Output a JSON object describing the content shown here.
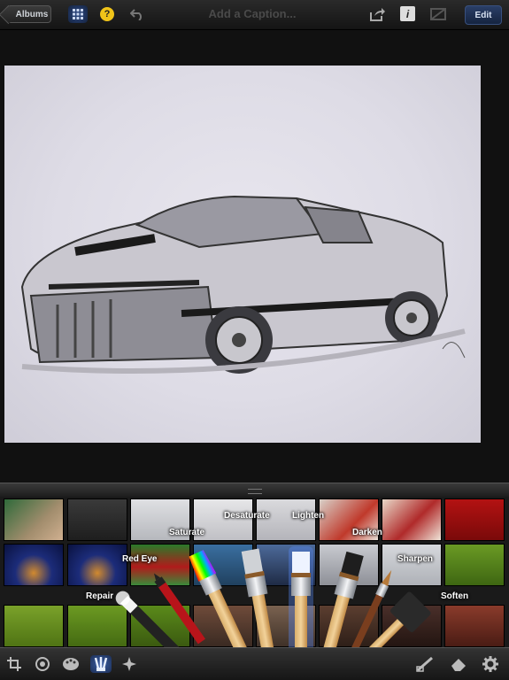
{
  "toolbar": {
    "albums_label": "Albums",
    "caption_placeholder": "Add a Caption...",
    "edit_label": "Edit",
    "help_glyph": "?",
    "info_glyph": "i",
    "icons": [
      "grid-icon",
      "help-icon",
      "undo-icon",
      "share-icon",
      "info-icon",
      "compare-icon"
    ]
  },
  "brush_tools": {
    "saturate": "Saturate",
    "desaturate": "Desaturate",
    "lighten": "Lighten",
    "darken": "Darken",
    "red_eye": "Red Eye",
    "sharpen": "Sharpen",
    "repair": "Repair",
    "soften": "Soften"
  },
  "bottom_tools": {
    "icons": [
      "crop-icon",
      "exposure-icon",
      "color-icon",
      "brushes-icon",
      "effects-icon",
      "brush-edit-icon",
      "eraser-icon",
      "settings-icon"
    ],
    "selected": "brushes-icon"
  },
  "colors": {
    "accent": "#2d4a86",
    "background": "#111111",
    "help": "#f0c419"
  }
}
